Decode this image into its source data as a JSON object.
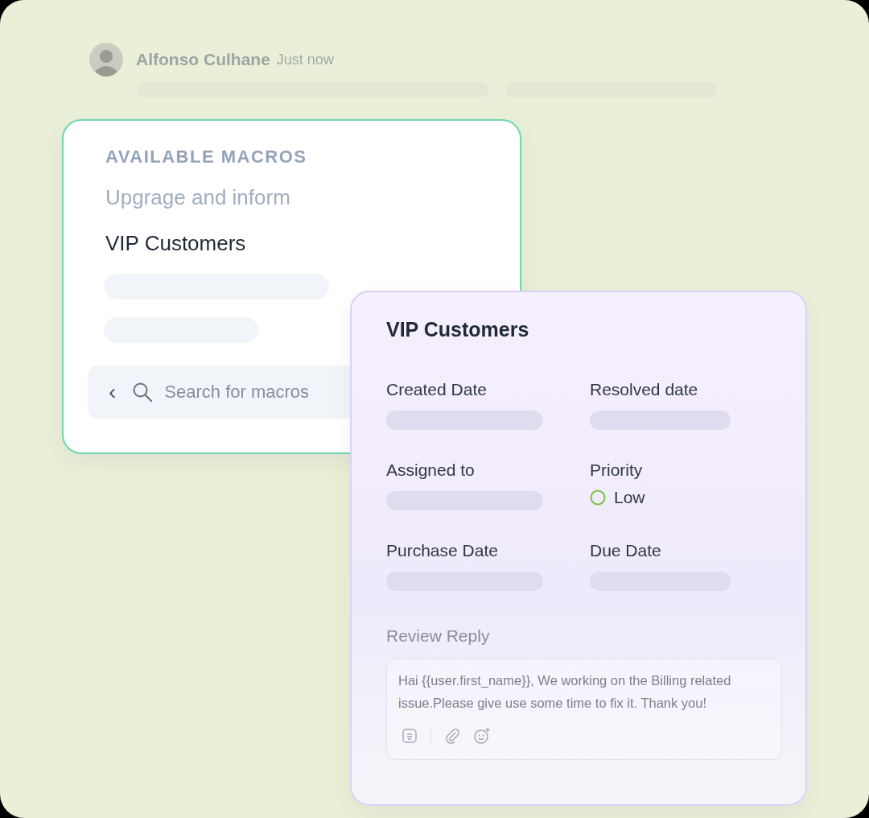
{
  "message": {
    "author": "Alfonso Culhane",
    "time": "Just now"
  },
  "macros": {
    "heading": "AVAILABLE MACROS",
    "items": [
      {
        "label": "Upgrage and inform",
        "selected": false
      },
      {
        "label": "VIP Customers",
        "selected": true
      }
    ],
    "back": "‹",
    "search": {
      "placeholder": "Search for macros"
    }
  },
  "details": {
    "title": "VIP Customers",
    "fields": [
      {
        "label": "Created Date",
        "kind": "skeleton"
      },
      {
        "label": "Resolved date",
        "kind": "skeleton"
      },
      {
        "label": "Assigned to",
        "kind": "skeleton"
      },
      {
        "label": "Priority",
        "kind": "status",
        "value": "Low"
      },
      {
        "label": "Purchase Date",
        "kind": "skeleton"
      },
      {
        "label": "Due Date",
        "kind": "skeleton"
      }
    ],
    "reply": {
      "label": "Review Reply",
      "value": "Hai {{user.first_name}}, We working on the Billing related issue.Please give use some time to fix it. Thank you!"
    }
  }
}
